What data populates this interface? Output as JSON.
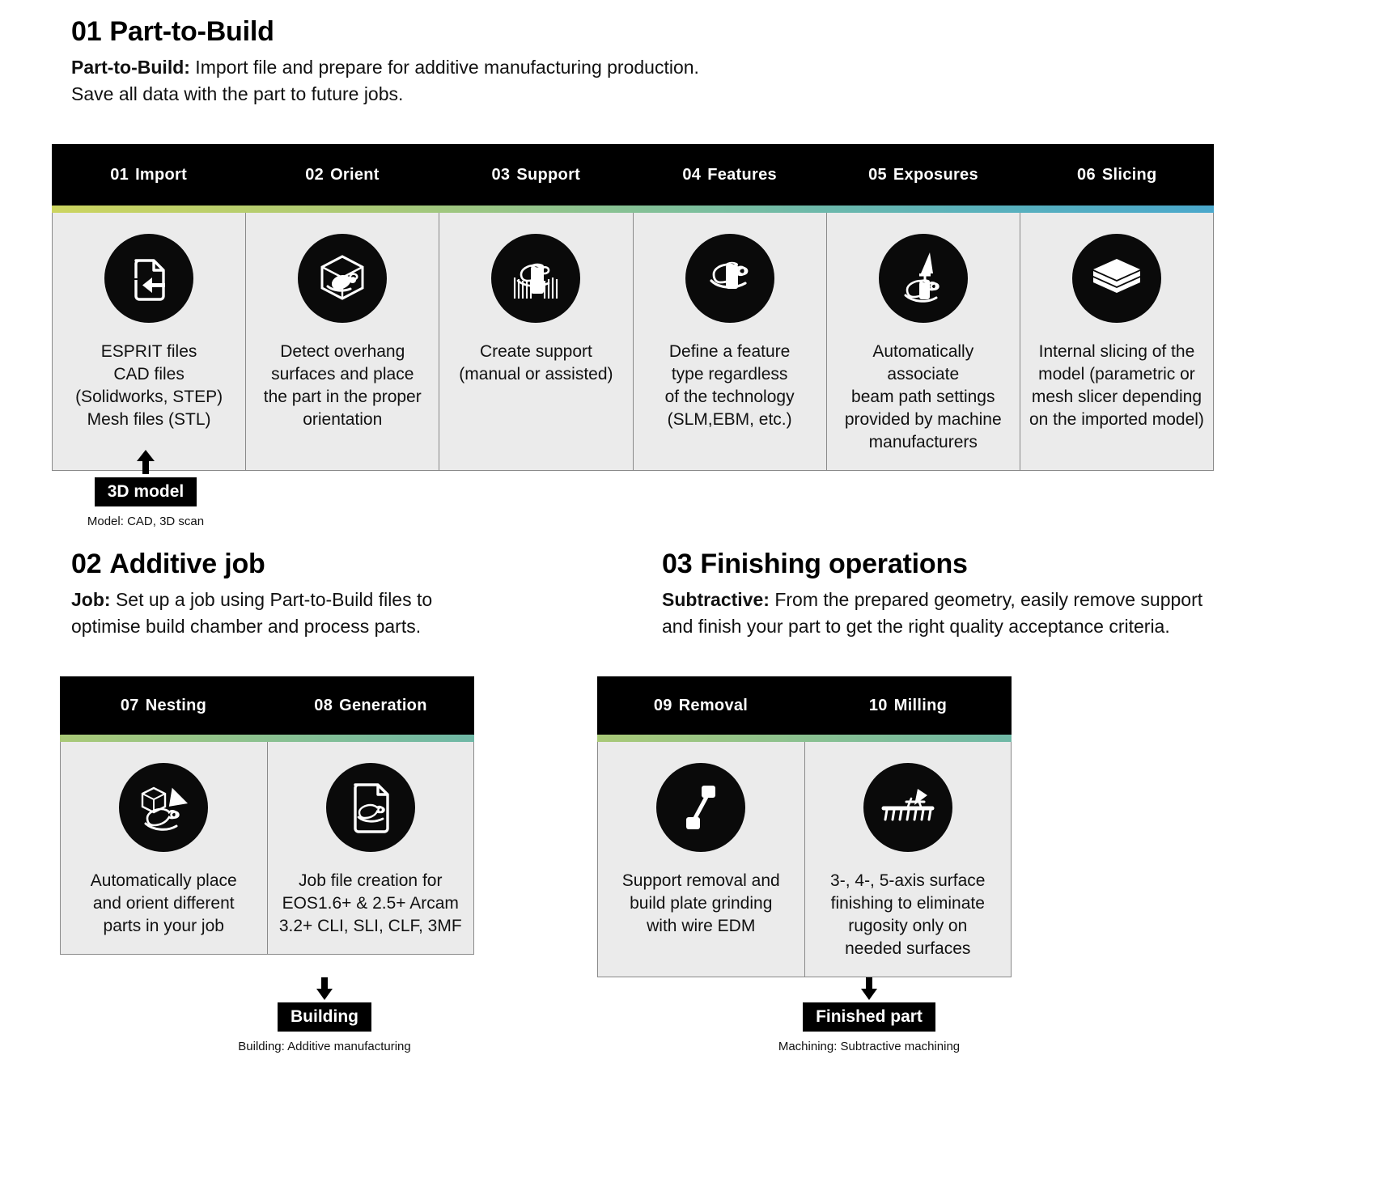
{
  "sections": [
    {
      "number": "01",
      "title": "Part-to-Build",
      "desc_lead": "Part-to-Build:",
      "desc_rest": " Import file and prepare for additive manufacturing production.\nSave all data with the part to future jobs."
    },
    {
      "number": "02",
      "title": "Additive job",
      "desc_lead": "Job:",
      "desc_rest": " Set up a job using Part-to-Build files to\noptimise build chamber and process parts."
    },
    {
      "number": "03",
      "title": "Finishing operations",
      "desc_lead": "Subtractive:",
      "desc_rest": " From the prepared geometry, easily remove support\nand finish your part to get the right quality acceptance criteria."
    }
  ],
  "colors": {
    "gradient_start": "#ccd45f",
    "gradient_end": "#4aa8cc",
    "header_bg": "#000000",
    "cell_bg": "#ebebeb",
    "cell_border": "#8a8a8a"
  },
  "table_main": {
    "steps": [
      {
        "num": "01",
        "label": "Import",
        "icon": "file-import-icon",
        "text": "ESPRIT files\nCAD files\n(Solidworks, STEP)\nMesh files (STL)"
      },
      {
        "num": "02",
        "label": "Orient",
        "icon": "part-in-cube-orient-icon",
        "text": "Detect overhang\nsurfaces and place\nthe part in the proper\norientation"
      },
      {
        "num": "03",
        "label": "Support",
        "icon": "part-with-supports-icon",
        "text": "Create support\n(manual or assisted)"
      },
      {
        "num": "04",
        "label": "Features",
        "icon": "part-feature-icon",
        "text": "Define a feature\ntype regardless\nof the technology\n(SLM,EBM, etc.)"
      },
      {
        "num": "05",
        "label": "Exposures",
        "icon": "laser-beam-part-icon",
        "text": "Automatically associate\nbeam path settings\nprovided by machine\nmanufacturers"
      },
      {
        "num": "06",
        "label": "Slicing",
        "icon": "stacked-layers-icon",
        "text": "Internal slicing of the\nmodel (parametric or\nmesh slicer depending\non the imported model)"
      }
    ]
  },
  "table_additive": {
    "steps": [
      {
        "num": "07",
        "label": "Nesting",
        "icon": "nesting-shapes-icon",
        "text": "Automatically place\nand orient different\nparts in your job"
      },
      {
        "num": "08",
        "label": "Generation",
        "icon": "job-file-icon",
        "text": "Job file creation for\nEOS1.6+ & 2.5+ Arcam\n3.2+ CLI, SLI, CLF, 3MF"
      }
    ]
  },
  "table_finishing": {
    "steps": [
      {
        "num": "09",
        "label": "Removal",
        "icon": "wire-edm-icon",
        "text": "Support removal and\nbuild plate grinding\nwith wire EDM"
      },
      {
        "num": "10",
        "label": "Milling",
        "icon": "milling-rake-icon",
        "text": "3-, 4-, 5-axis surface\nfinishing to eliminate\nrugosity only on\nneeded surfaces"
      }
    ]
  },
  "flows": {
    "input": {
      "badge": "3D model",
      "caption": "Model: CAD, 3D scan",
      "direction": "up"
    },
    "building": {
      "badge": "Building",
      "caption": "Building: Additive manufacturing",
      "direction": "down"
    },
    "finished": {
      "badge": "Finished part",
      "caption": "Machining: Subtractive machining",
      "direction": "down"
    }
  }
}
